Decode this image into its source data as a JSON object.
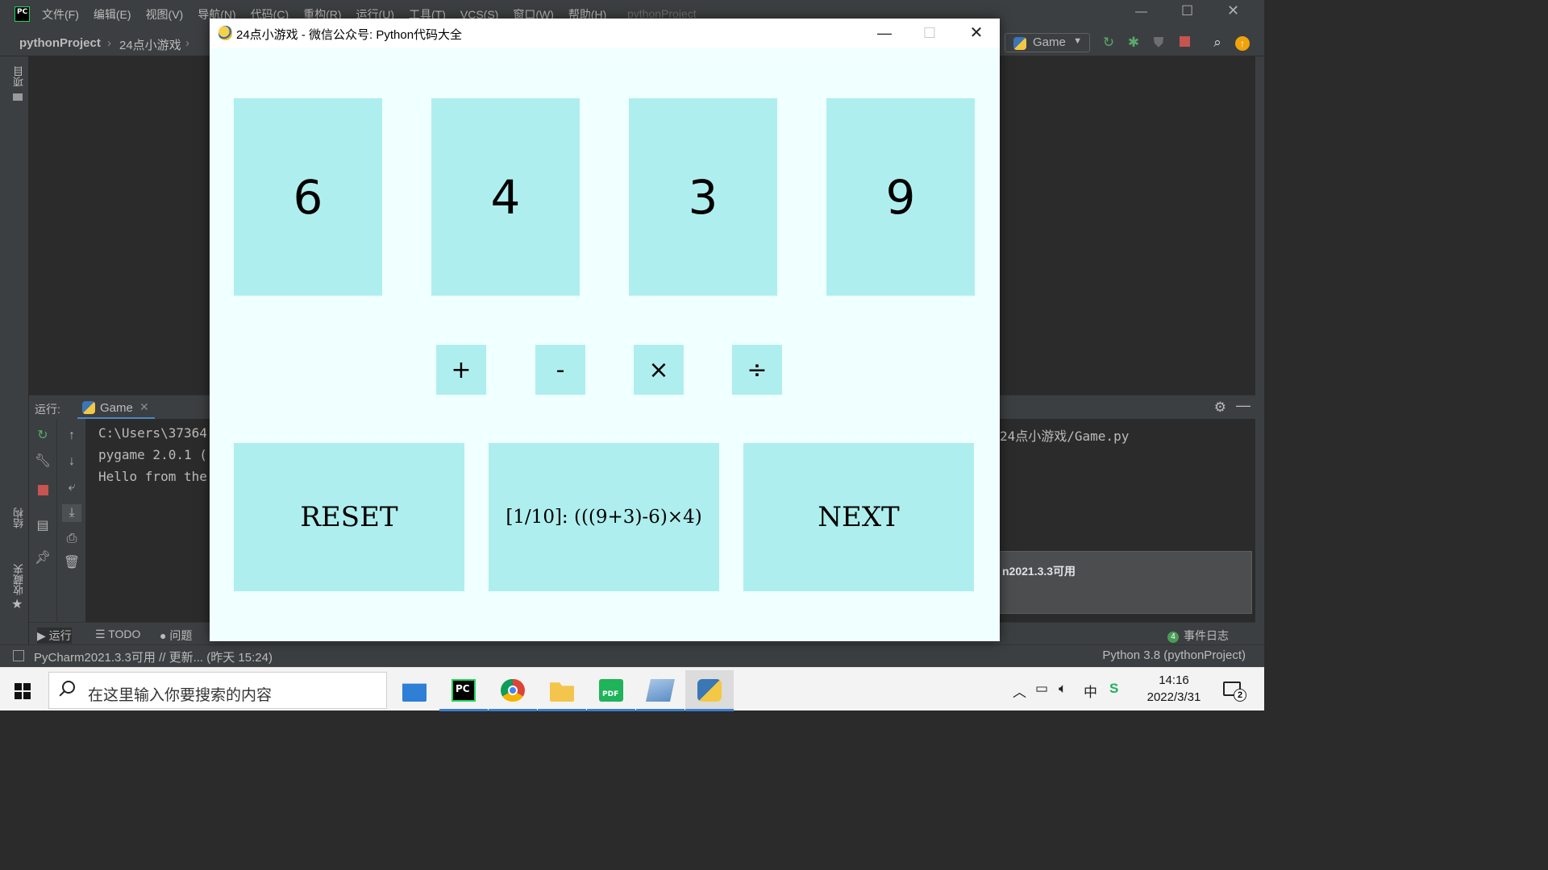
{
  "ide": {
    "menus": [
      "文件(F)",
      "编辑(E)",
      "视图(V)",
      "导航(N)",
      "代码(C)",
      "重构(R)",
      "运行(U)",
      "工具(T)",
      "VCS(S)",
      "窗口(W)",
      "帮助(H)"
    ],
    "title": "pythonProject",
    "breadcrumb": [
      "pythonProject",
      "24点小游戏"
    ],
    "run_config": "Game",
    "sidebar_labels": [
      "项目",
      "结构",
      "收藏夹"
    ],
    "run_panel": {
      "label": "运行:",
      "tab": "Game",
      "console_lines": [
        "C:\\Users\\37364",
        "pygame 2.0.1 (",
        "Hello from the"
      ],
      "console_path": "24点小游戏/Game.py"
    },
    "notification": "n2021.3.3可用",
    "toolwindows": [
      "运行",
      "TODO",
      "问题"
    ],
    "event_log": {
      "count": "4",
      "label": "事件日志"
    },
    "status_left": "PyCharm2021.3.3可用 // 更新... (昨天 15:24)",
    "status_right": "Python 3.8 (pythonProject)"
  },
  "game": {
    "title": "24点小游戏 - 微信公众号: Python代码大全",
    "cards": [
      "6",
      "4",
      "3",
      "9"
    ],
    "operators": [
      "+",
      "-",
      "×",
      "÷"
    ],
    "reset_label": "RESET",
    "answer_text": "[1/10]: (((9+3)-6)×4)",
    "next_label": "NEXT",
    "colors": {
      "card": "#afeeee",
      "background": "#f0ffff"
    }
  },
  "taskbar": {
    "search_placeholder": "在这里输入你要搜索的内容",
    "apps": [
      "mail-icon",
      "pycharm-icon",
      "chrome-icon",
      "file-explorer-icon",
      "pdf-icon",
      "notepad-icon",
      "python-icon"
    ],
    "time": "14:16",
    "date": "2022/3/31",
    "ime": "中",
    "notification_count": "2"
  }
}
